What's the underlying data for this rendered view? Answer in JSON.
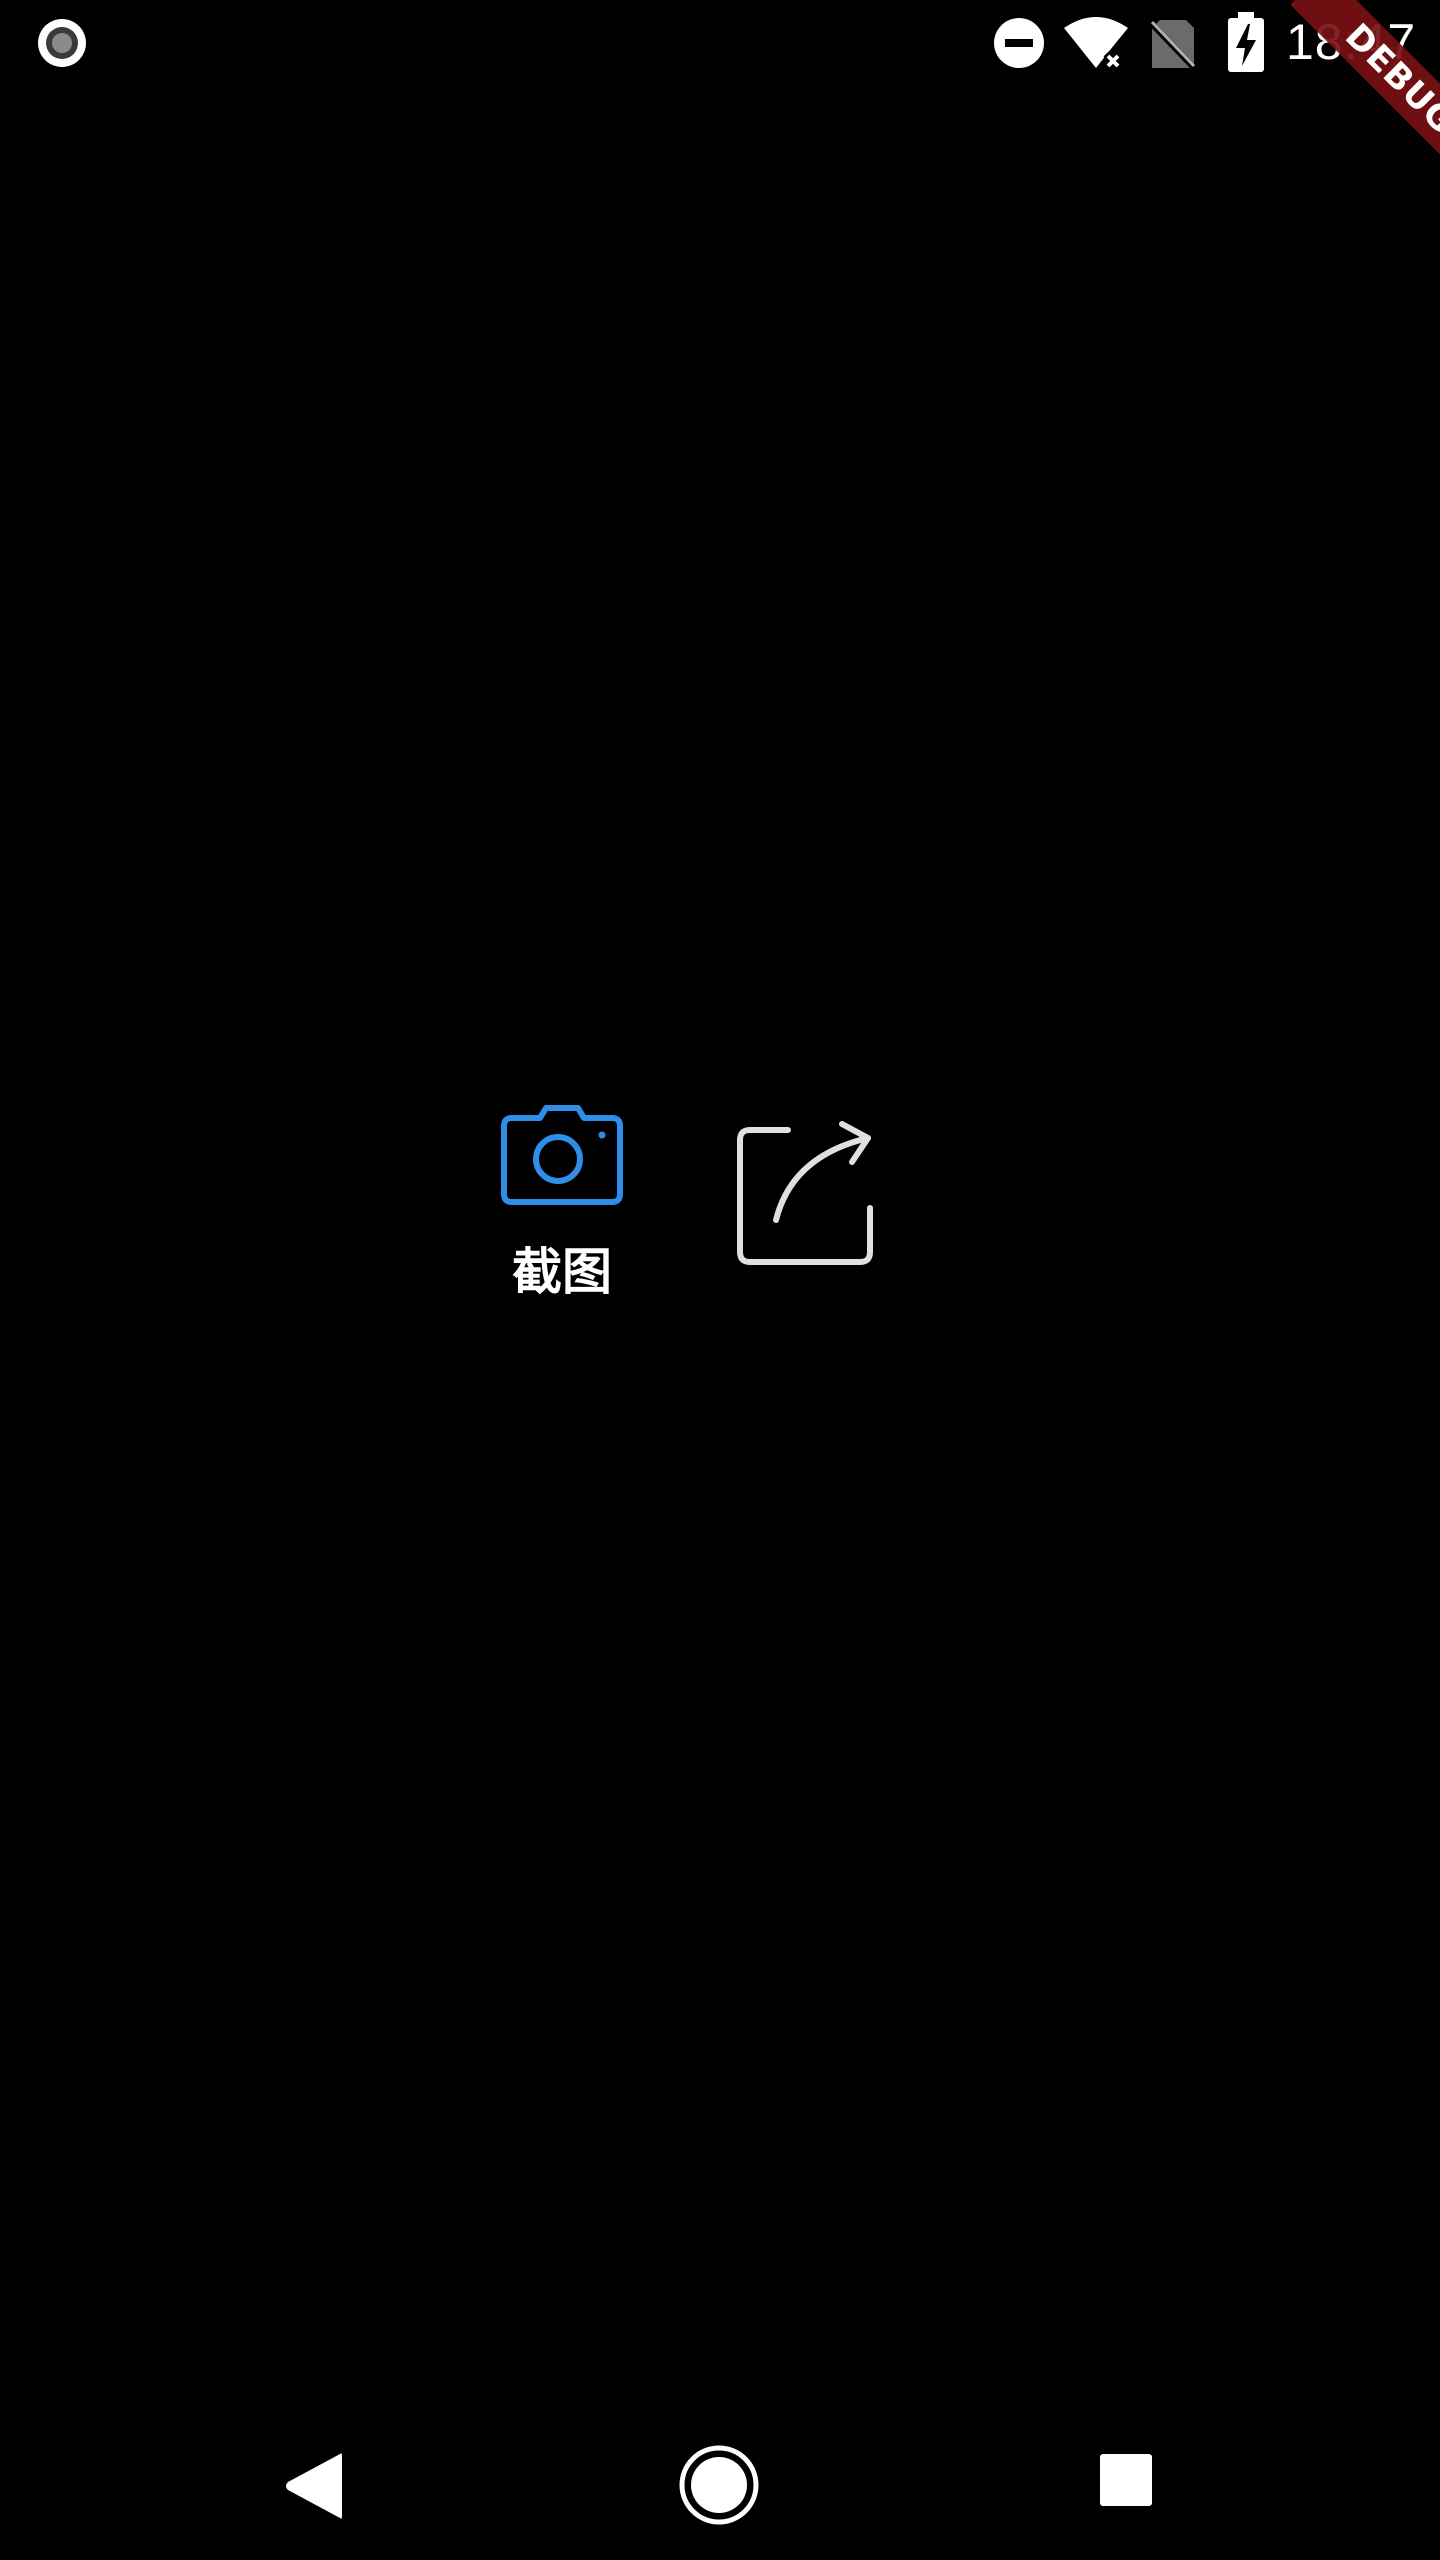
{
  "status_bar": {
    "time": "18:47",
    "icons": [
      "screen-record-icon",
      "do-not-disturb-icon",
      "wifi-no-internet-icon",
      "no-sim-icon",
      "battery-charging-icon"
    ]
  },
  "debug_banner": {
    "label": "DEBUG",
    "color": "#7a1012"
  },
  "actions": {
    "screenshot": {
      "label": "截图",
      "icon": "camera-icon",
      "color": "#2f8fe8"
    },
    "share": {
      "icon": "share-icon",
      "color": "#e0e0e0"
    }
  },
  "nav_bar": {
    "icons": [
      "back-icon",
      "home-icon",
      "recents-icon"
    ]
  }
}
